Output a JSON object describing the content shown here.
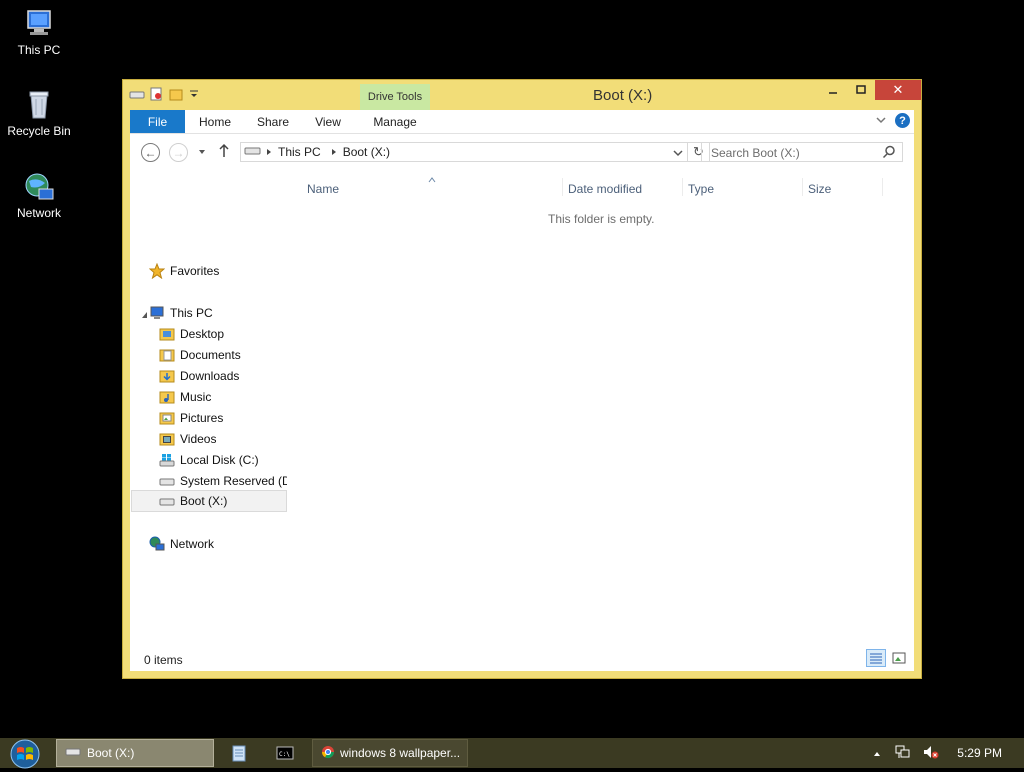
{
  "desktop": {
    "icons": [
      {
        "label": "This PC"
      },
      {
        "label": "Recycle Bin"
      },
      {
        "label": "Network"
      }
    ]
  },
  "window": {
    "title": "Boot (X:)",
    "contextual_tab": "Drive Tools",
    "ribbon_tabs": {
      "file": "File",
      "home": "Home",
      "share": "Share",
      "view": "View",
      "manage": "Manage"
    },
    "help": "?",
    "breadcrumb": [
      "This PC",
      "Boot (X:)"
    ],
    "search_placeholder": "Search Boot (X:)",
    "nav": {
      "favorites": "Favorites",
      "this_pc": "This PC",
      "children": [
        "Desktop",
        "Documents",
        "Downloads",
        "Music",
        "Pictures",
        "Videos",
        "Local Disk (C:)",
        "System Reserved (D:",
        "Boot (X:)"
      ],
      "network": "Network"
    },
    "columns": {
      "name": "Name",
      "date_modified": "Date modified",
      "type": "Type",
      "size": "Size"
    },
    "empty_message": "This folder is empty.",
    "status": "0 items"
  },
  "taskbar": {
    "items": [
      {
        "label": "Boot (X:)"
      },
      {
        "label": "windows 8 wallpaper..."
      }
    ],
    "clock": "5:29 PM"
  },
  "colors": {
    "window_frame": "#f2dd78",
    "file_tab": "#1979ca",
    "drive_tools": "#c9e8a2",
    "close_button": "#c7453a",
    "taskbar": "#3b3a22"
  }
}
